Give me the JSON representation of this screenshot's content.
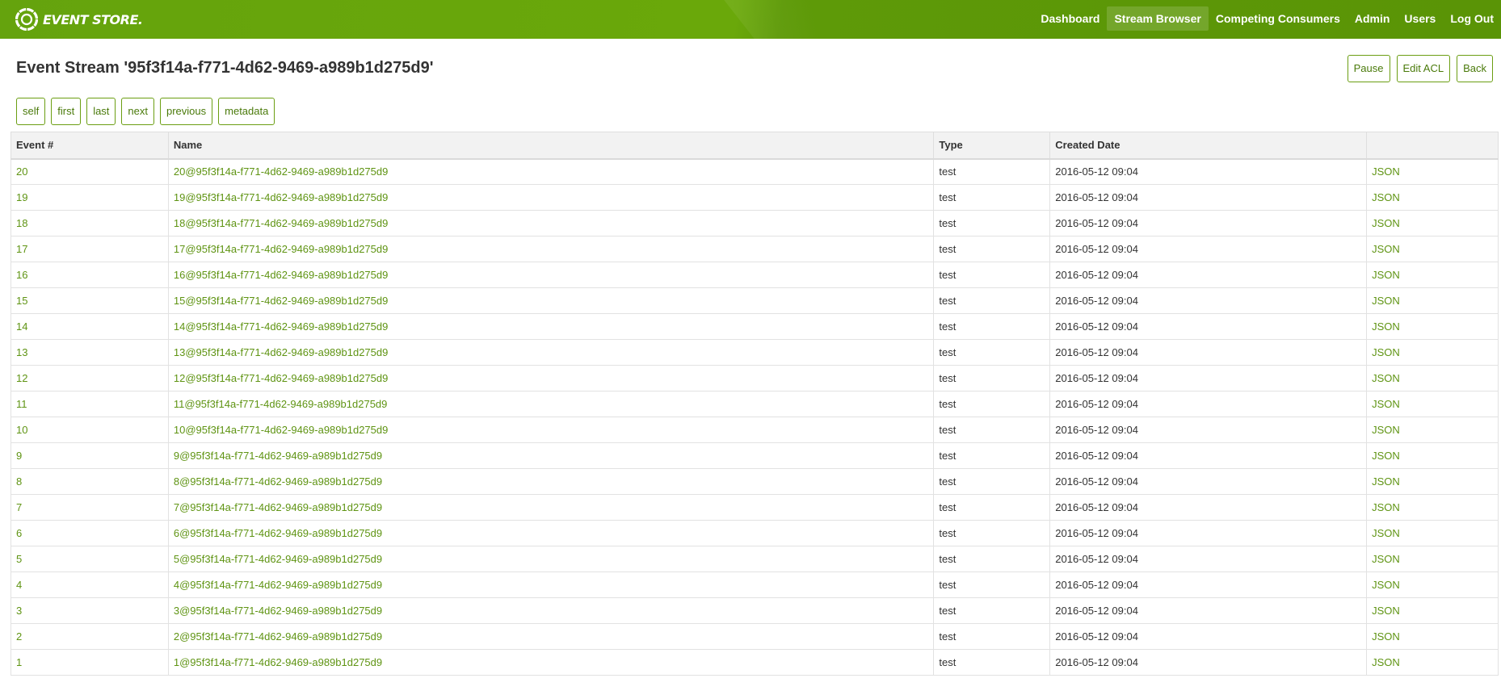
{
  "header": {
    "logo_text": "EVENT STORE.",
    "nav": [
      {
        "label": "Dashboard",
        "active": false
      },
      {
        "label": "Stream Browser",
        "active": true
      },
      {
        "label": "Competing Consumers",
        "active": false
      },
      {
        "label": "Admin",
        "active": false
      },
      {
        "label": "Users",
        "active": false
      },
      {
        "label": "Log Out",
        "active": false
      }
    ]
  },
  "page": {
    "title": "Event Stream '95f3f14a-f771-4d62-9469-a989b1d275d9'",
    "actions": {
      "pause": "Pause",
      "edit_acl": "Edit ACL",
      "back": "Back"
    },
    "links": [
      "self",
      "first",
      "last",
      "next",
      "previous",
      "metadata"
    ]
  },
  "table": {
    "columns": [
      "Event #",
      "Name",
      "Type",
      "Created Date",
      ""
    ],
    "rows": [
      {
        "event": "20",
        "name": "20@95f3f14a-f771-4d62-9469-a989b1d275d9",
        "type": "test",
        "created": "2016-05-12 09:04",
        "link": "JSON"
      },
      {
        "event": "19",
        "name": "19@95f3f14a-f771-4d62-9469-a989b1d275d9",
        "type": "test",
        "created": "2016-05-12 09:04",
        "link": "JSON"
      },
      {
        "event": "18",
        "name": "18@95f3f14a-f771-4d62-9469-a989b1d275d9",
        "type": "test",
        "created": "2016-05-12 09:04",
        "link": "JSON"
      },
      {
        "event": "17",
        "name": "17@95f3f14a-f771-4d62-9469-a989b1d275d9",
        "type": "test",
        "created": "2016-05-12 09:04",
        "link": "JSON"
      },
      {
        "event": "16",
        "name": "16@95f3f14a-f771-4d62-9469-a989b1d275d9",
        "type": "test",
        "created": "2016-05-12 09:04",
        "link": "JSON"
      },
      {
        "event": "15",
        "name": "15@95f3f14a-f771-4d62-9469-a989b1d275d9",
        "type": "test",
        "created": "2016-05-12 09:04",
        "link": "JSON"
      },
      {
        "event": "14",
        "name": "14@95f3f14a-f771-4d62-9469-a989b1d275d9",
        "type": "test",
        "created": "2016-05-12 09:04",
        "link": "JSON"
      },
      {
        "event": "13",
        "name": "13@95f3f14a-f771-4d62-9469-a989b1d275d9",
        "type": "test",
        "created": "2016-05-12 09:04",
        "link": "JSON"
      },
      {
        "event": "12",
        "name": "12@95f3f14a-f771-4d62-9469-a989b1d275d9",
        "type": "test",
        "created": "2016-05-12 09:04",
        "link": "JSON"
      },
      {
        "event": "11",
        "name": "11@95f3f14a-f771-4d62-9469-a989b1d275d9",
        "type": "test",
        "created": "2016-05-12 09:04",
        "link": "JSON"
      },
      {
        "event": "10",
        "name": "10@95f3f14a-f771-4d62-9469-a989b1d275d9",
        "type": "test",
        "created": "2016-05-12 09:04",
        "link": "JSON"
      },
      {
        "event": "9",
        "name": "9@95f3f14a-f771-4d62-9469-a989b1d275d9",
        "type": "test",
        "created": "2016-05-12 09:04",
        "link": "JSON"
      },
      {
        "event": "8",
        "name": "8@95f3f14a-f771-4d62-9469-a989b1d275d9",
        "type": "test",
        "created": "2016-05-12 09:04",
        "link": "JSON"
      },
      {
        "event": "7",
        "name": "7@95f3f14a-f771-4d62-9469-a989b1d275d9",
        "type": "test",
        "created": "2016-05-12 09:04",
        "link": "JSON"
      },
      {
        "event": "6",
        "name": "6@95f3f14a-f771-4d62-9469-a989b1d275d9",
        "type": "test",
        "created": "2016-05-12 09:04",
        "link": "JSON"
      },
      {
        "event": "5",
        "name": "5@95f3f14a-f771-4d62-9469-a989b1d275d9",
        "type": "test",
        "created": "2016-05-12 09:04",
        "link": "JSON"
      },
      {
        "event": "4",
        "name": "4@95f3f14a-f771-4d62-9469-a989b1d275d9",
        "type": "test",
        "created": "2016-05-12 09:04",
        "link": "JSON"
      },
      {
        "event": "3",
        "name": "3@95f3f14a-f771-4d62-9469-a989b1d275d9",
        "type": "test",
        "created": "2016-05-12 09:04",
        "link": "JSON"
      },
      {
        "event": "2",
        "name": "2@95f3f14a-f771-4d62-9469-a989b1d275d9",
        "type": "test",
        "created": "2016-05-12 09:04",
        "link": "JSON"
      },
      {
        "event": "1",
        "name": "1@95f3f14a-f771-4d62-9469-a989b1d275d9",
        "type": "test",
        "created": "2016-05-12 09:04",
        "link": "JSON"
      }
    ]
  },
  "colors": {
    "header_green": "#65a30d",
    "link_green": "#5f9413",
    "button_border": "#6b9e12"
  },
  "icons": {
    "logo": "event-store-logo-icon"
  }
}
